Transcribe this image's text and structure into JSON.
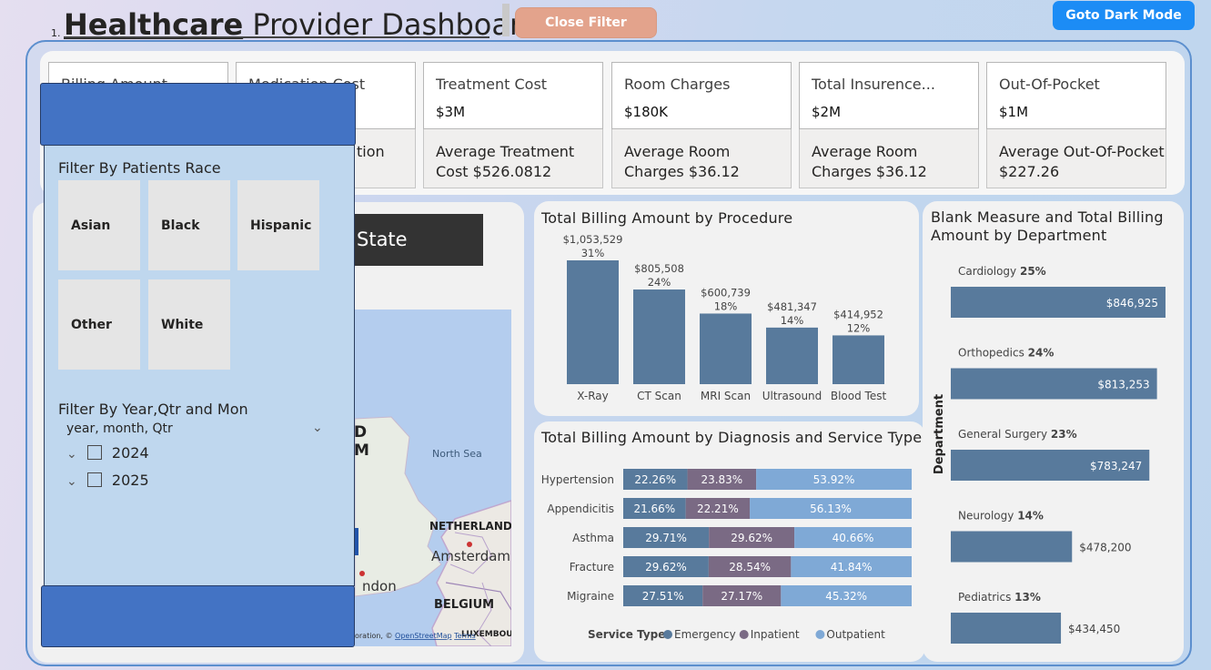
{
  "header": {
    "prefix": "1.",
    "title_bold": "Healthcare",
    "title_rest": " Provider Dashboard",
    "close_filter": "Close Filter",
    "dark_mode": "Goto Dark Mode"
  },
  "kpis": [
    {
      "label": "Billing Amount",
      "value": "",
      "sub": ""
    },
    {
      "label": "Medication Cost",
      "value": "",
      "sub": "tion"
    },
    {
      "label": "Treatment Cost",
      "value": "$3M",
      "sub": "Average Treatment Cost $526.0812"
    },
    {
      "label": "Room Charges",
      "value": "$180K",
      "sub": "Average Room Charges $36.12"
    },
    {
      "label": "Total Insurence...",
      "value": "$2M",
      "sub": "Average Room Charges $36.12"
    },
    {
      "label": "Out-Of-Pocket",
      "value": "$1M",
      "sub": "Average Out-Of-Pocket $227.26"
    }
  ],
  "map": {
    "state_button": "State",
    "labels": {
      "north_sea": "North Sea",
      "netherlands": "NETHERLANDS",
      "amsterdam": "Amsterdam",
      "belgium": "BELGIUM",
      "london": "ndon",
      "partial_d": "D",
      "partial_m": "M",
      "luxembourg": "LUXEMBOU"
    },
    "attribution_prefix": "oration, © ",
    "attribution_osm": "OpenStreetMap",
    "attribution_terms": "Terms"
  },
  "filter": {
    "race_title": "Filter By Patients Race",
    "races": [
      "Asian",
      "Black",
      "Hispanic",
      "Other",
      "White"
    ],
    "date_title": "Filter By Year,Qtr and Mon",
    "date_hierarchy": "year, month, Qtr",
    "years": [
      "2024",
      "2025"
    ]
  },
  "chart_data": [
    {
      "type": "bar",
      "title": "Total Billing Amount by Procedure",
      "categories": [
        "X-Ray",
        "CT Scan",
        "MRI Scan",
        "Ultrasound",
        "Blood Test"
      ],
      "values": [
        1053529,
        805508,
        600739,
        481347,
        414952
      ],
      "value_labels": [
        "$1,053,529",
        "$805,508",
        "$600,739",
        "$481,347",
        "$414,952"
      ],
      "percent_labels": [
        "31%",
        "24%",
        "18%",
        "14%",
        "12%"
      ],
      "color": "#587a9c"
    },
    {
      "type": "bar",
      "orientation": "horizontal-stacked-100",
      "title": "Total Billing Amount by Diagnosis and Service Type",
      "categories": [
        "Hypertension",
        "Appendicitis",
        "Asthma",
        "Fracture",
        "Migraine"
      ],
      "series": [
        {
          "name": "Emergency",
          "values": [
            22.26,
            21.66,
            29.71,
            29.62,
            27.51
          ],
          "labels": [
            "22.26%",
            "21.66%",
            "29.71%",
            "29.62%",
            "27.51%"
          ],
          "color": "#587a9c"
        },
        {
          "name": "Inpatient",
          "values": [
            23.83,
            22.21,
            29.62,
            28.54,
            27.17
          ],
          "labels": [
            "23.83%",
            "22.21%",
            "29.62%",
            "28.54%",
            "27.17%"
          ],
          "color": "#7a6a84"
        },
        {
          "name": "Outpatient",
          "values": [
            53.92,
            56.13,
            40.66,
            41.84,
            45.32
          ],
          "labels": [
            "53.92%",
            "56.13%",
            "40.66%",
            "41.84%",
            "45.32%"
          ],
          "color": "#7fa9d6"
        }
      ],
      "legend_title": "Service Type",
      "legend_position": "bottom"
    },
    {
      "type": "bar",
      "orientation": "horizontal",
      "title": "Blank Measure and Total Billing Amount by Department",
      "ylabel": "Department",
      "categories": [
        "Cardiology",
        "Orthopedics",
        "General Surgery",
        "Neurology",
        "Pediatrics"
      ],
      "percent_labels": [
        "25%",
        "24%",
        "23%",
        "14%",
        "13%"
      ],
      "values": [
        846925,
        813253,
        783247,
        478200,
        434450
      ],
      "value_labels": [
        "$846,925",
        "$813,253",
        "$783,247",
        "$478,200",
        "$434,450"
      ],
      "color": "#587a9c"
    }
  ]
}
